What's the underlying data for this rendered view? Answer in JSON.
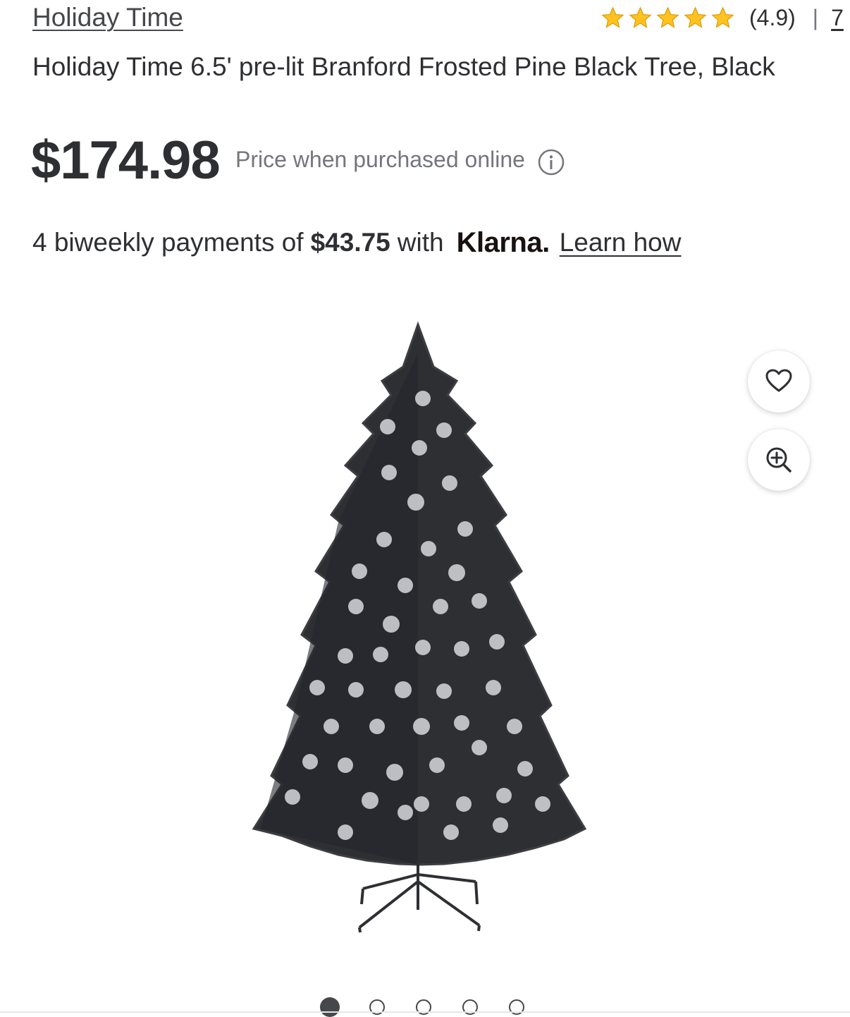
{
  "brand": {
    "name": "Holiday Time"
  },
  "rating": {
    "stars": 5,
    "value": "(4.9)",
    "separator": "|",
    "review_count": "7",
    "star_color": "#ffc220"
  },
  "product": {
    "title": "Holiday Time 6.5' pre-lit Branford Frosted Pine Black Tree, Black"
  },
  "price": {
    "amount": "$174.98",
    "note": "Price when purchased online"
  },
  "klarna": {
    "prefix": "4 biweekly payments of",
    "amount": "$43.75",
    "with": "with",
    "logo": "Klarna.",
    "link": "Learn how"
  },
  "image_actions": {
    "favorite_icon": "heart-icon",
    "zoom_icon": "zoom-in-icon"
  },
  "carousel": {
    "count": 5,
    "active": 1
  }
}
